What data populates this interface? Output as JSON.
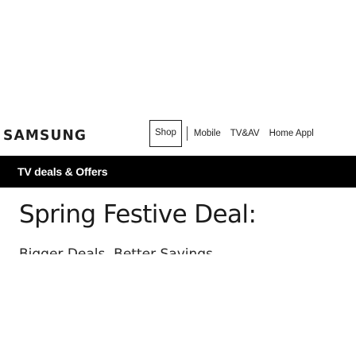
{
  "header": {
    "logo": "SAMSUNG",
    "nav": [
      {
        "label": "Shop",
        "selected": true
      },
      {
        "label": "Mobile",
        "selected": false
      },
      {
        "label": "TV&AV",
        "selected": false
      },
      {
        "label": "Home Appl",
        "selected": false
      }
    ]
  },
  "banner": {
    "text": "TV deals & Offers",
    "background": "#000000",
    "text_color": "#ffffff"
  },
  "hero": {
    "title": "Spring Festive Deal:",
    "subtitle": "Bigger Deals. Better Savings"
  }
}
